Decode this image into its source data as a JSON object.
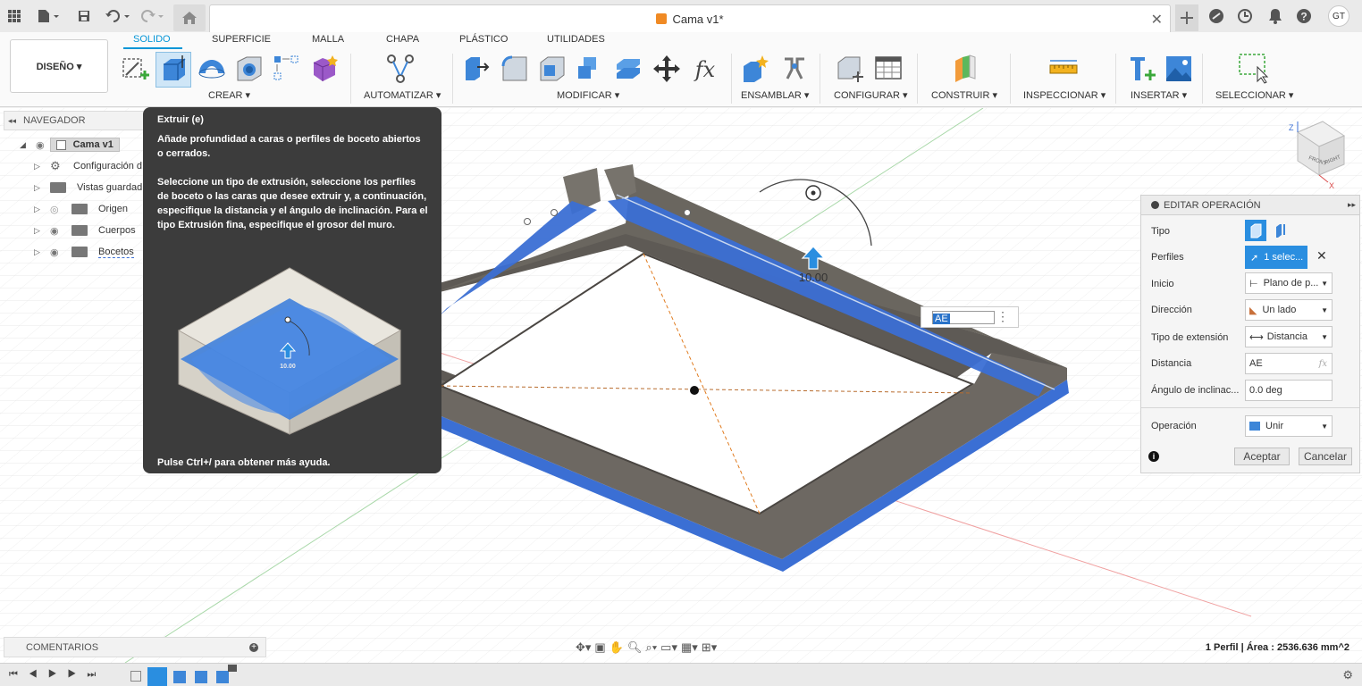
{
  "titlebar": {
    "document_title": "Cama v1*",
    "user_initials": "GT",
    "icons": [
      "apps-grid-icon",
      "file-icon",
      "save-icon",
      "undo-icon",
      "redo-icon",
      "home-icon",
      "close-icon",
      "new-tab-plus-icon",
      "extensions-icon",
      "job-status-icon",
      "notifications-bell-icon",
      "help-icon"
    ]
  },
  "ribbon": {
    "workspace_label": "DISEÑO ▾",
    "tabs": [
      "SOLIDO",
      "SUPERFICIE",
      "MALLA",
      "CHAPA",
      "PLÁSTICO",
      "UTILIDADES"
    ],
    "active_tab": "SOLIDO",
    "groups": [
      "CREAR ▾",
      "AUTOMATIZAR ▾",
      "MODIFICAR ▾",
      "ENSAMBLAR ▾",
      "CONFIGURAR ▾",
      "CONSTRUIR ▾",
      "INSPECCIONAR ▾",
      "INSERTAR ▾",
      "SELECCIONAR ▾"
    ]
  },
  "browser": {
    "header": "NAVEGADOR",
    "root": "Cama v1",
    "items": [
      {
        "label": "Configuración d",
        "icon": "gear-icon"
      },
      {
        "label": "Vistas guardad",
        "icon": "folder-icon"
      },
      {
        "label": "Origen",
        "icon": "folder-icon"
      },
      {
        "label": "Cuerpos",
        "icon": "folder-icon"
      },
      {
        "label": "Bocetos",
        "icon": "folder-icon"
      }
    ]
  },
  "tooltip": {
    "title": "Extruir (e)",
    "paragraph1": "Añade profundidad a caras o perfiles de boceto abiertos o cerrados.",
    "paragraph2": "Seleccione un tipo de extrusión, seleccione los perfiles de boceto o las caras que desee extruir y, a continuación, especifique la distancia y el ángulo de inclinación. Para el tipo Extrusión fina, especifique el grosor del muro.",
    "illustration_value": "10.00",
    "footer": "Pulse Ctrl+/ para obtener más ayuda."
  },
  "viewport": {
    "dimension_value": "10.00",
    "distance_input": "AE",
    "viewcube": {
      "top": "Z",
      "front": "FRONT",
      "right": "RIGHT",
      "axis_x": "X"
    }
  },
  "edit_panel": {
    "header": "EDITAR OPERACIÓN",
    "rows": {
      "tipo": "Tipo",
      "perfiles": "Perfiles",
      "perfiles_value": "1 selec...",
      "inicio": "Inicio",
      "inicio_value": "Plano de p...",
      "direccion": "Dirección",
      "direccion_value": "Un lado",
      "tipo_extension": "Tipo de extensión",
      "tipo_extension_value": "Distancia",
      "distancia": "Distancia",
      "distancia_value": "AE",
      "angulo": "Ángulo de inclinac...",
      "angulo_value": "0.0 deg",
      "operacion": "Operación",
      "operacion_value": "Unir"
    },
    "fx": "fx",
    "accept": "Aceptar",
    "cancel": "Cancelar"
  },
  "bottom": {
    "comments": "COMENTARIOS",
    "status": "1 Perfil | Área : 2536.636 mm^2"
  },
  "colors": {
    "accent": "#0696d7",
    "selection_blue": "#3f7fdc",
    "body_gray": "#6f6b66",
    "tooltip_bg": "#3c3c3c"
  }
}
